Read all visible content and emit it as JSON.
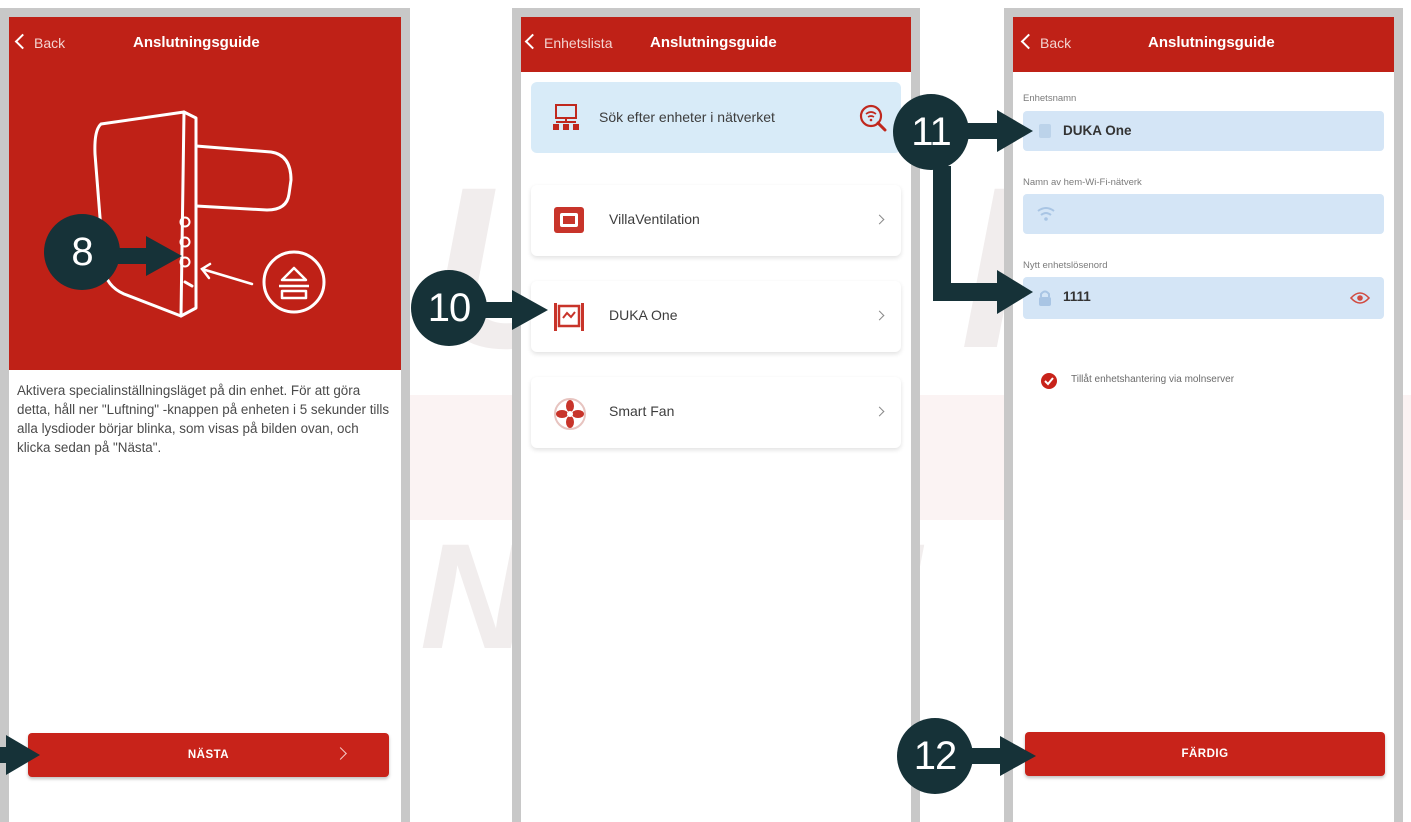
{
  "phone1": {
    "nav": {
      "back": "Back",
      "title": "Anslutningsguide"
    },
    "description": "Aktivera specialinställningsläget på din enhet. För att göra detta, håll ner \"Luftning\" -knappen på enheten i 5 sekunder tills alla lysdioder börjar blinka, som visas på bilden ovan, och klicka sedan på \"Nästa\".",
    "next_button": "NÄSTA"
  },
  "phone2": {
    "nav": {
      "back": "Enhetslista",
      "title": "Anslutningsguide"
    },
    "search": {
      "label": "Sök efter enheter i nätverket",
      "icon": "search-wifi-icon"
    },
    "devices": [
      {
        "label": "VillaVentilation",
        "icon": "villa-ventilation-icon"
      },
      {
        "label": "DUKA One",
        "icon": "duka-one-icon"
      },
      {
        "label": "Smart Fan",
        "icon": "smart-fan-icon"
      }
    ]
  },
  "phone3": {
    "nav": {
      "back": "Back",
      "title": "Anslutningsguide"
    },
    "device_name_label": "Enhetsnamn",
    "device_name_value": "DUKA One",
    "wifi_label": "Namn av hem-Wi-Fi-nätverk",
    "wifi_value": "",
    "password_label": "Nytt enhetslösenord",
    "password_value": "1111",
    "cloud_checkbox_label": "Tillåt enhetshantering via molnserver",
    "cloud_checkbox_checked": true,
    "done_button": "FÄRDIG"
  },
  "callouts": [
    "8",
    "10",
    "11",
    "12"
  ],
  "colors": {
    "brand_red": "#bf2117",
    "callout": "#163238",
    "field_blue": "#d4e5f6"
  }
}
